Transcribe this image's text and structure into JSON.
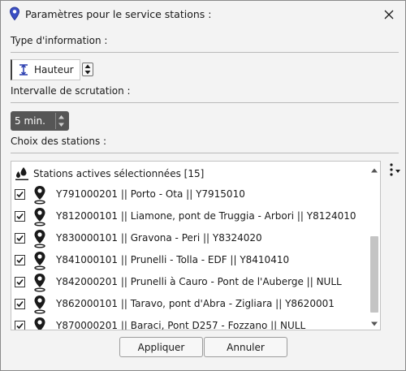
{
  "window": {
    "title": "Paramètres pour le service stations :"
  },
  "info_type": {
    "label": "Type d'information :",
    "value": "Hauteur"
  },
  "interval": {
    "label": "Intervalle de scrutation :",
    "value": "5 min."
  },
  "stations": {
    "label": "Choix des stations :",
    "header": "Stations actives sélectionnées [15]",
    "items": [
      {
        "label": "Y791000201 || Porto - Ota || Y7915010",
        "checked": true
      },
      {
        "label": "Y812000101 || Liamone, pont de Truggia - Arbori || Y8124010",
        "checked": true
      },
      {
        "label": "Y830000101 || Gravona - Peri || Y8324020",
        "checked": true
      },
      {
        "label": "Y841000101 || Prunelli - Tolla - EDF || Y8410410",
        "checked": true
      },
      {
        "label": "Y842000201 || Prunelli à Cauro - Pont de l'Auberge || NULL",
        "checked": true
      },
      {
        "label": "Y862000101 || Taravo, pont d'Abra - Zigliara || Y8620001",
        "checked": true
      },
      {
        "label": "Y870000201 || Baraci, Pont D257 - Fozzano || NULL",
        "checked": true
      }
    ]
  },
  "buttons": {
    "apply": "Appliquer",
    "cancel": "Annuler"
  },
  "colors": {
    "accent": "#2b3fb0",
    "list_bg": "#ffffff",
    "interval_bg": "#565656"
  }
}
